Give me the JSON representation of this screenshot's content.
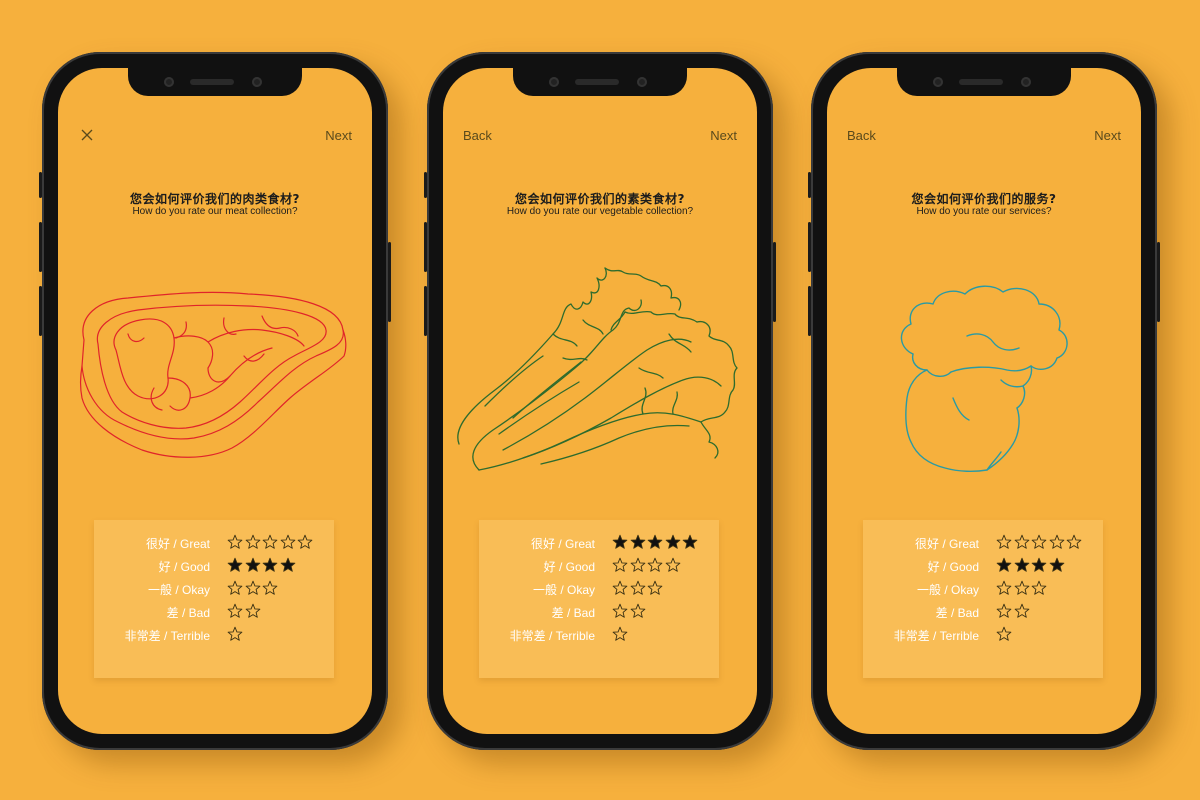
{
  "colors": {
    "background": "#F6B03D",
    "meat_line": "#E0242A",
    "veg_line": "#2E6B2D",
    "chef_line": "#2A9AA4"
  },
  "screens": [
    {
      "nav_left": "",
      "nav_left_icon": "close-icon",
      "nav_right": "Next",
      "question_cn": "您会如何评价我们的肉类食材?",
      "question_en": "How do you rate our meat collection?",
      "illustration": "steak",
      "ratings": [
        {
          "label": "很好 / Great",
          "stars": 5,
          "filled": false
        },
        {
          "label": "好 / Good",
          "stars": 4,
          "filled": true
        },
        {
          "label": "一般 / Okay",
          "stars": 3,
          "filled": false
        },
        {
          "label": "差 / Bad",
          "stars": 2,
          "filled": false
        },
        {
          "label": "非常差 / Terrible",
          "stars": 1,
          "filled": false
        }
      ]
    },
    {
      "nav_left": "Back",
      "nav_right": "Next",
      "question_cn": "您会如何评价我们的素类食材?",
      "question_en": "How do you rate our vegetable collection?",
      "illustration": "cabbage",
      "ratings": [
        {
          "label": "很好 / Great",
          "stars": 5,
          "filled": true
        },
        {
          "label": "好 / Good",
          "stars": 4,
          "filled": false
        },
        {
          "label": "一般 / Okay",
          "stars": 3,
          "filled": false
        },
        {
          "label": "差 / Bad",
          "stars": 2,
          "filled": false
        },
        {
          "label": "非常差 / Terrible",
          "stars": 1,
          "filled": false
        }
      ]
    },
    {
      "nav_left": "Back",
      "nav_right": "Next",
      "question_cn": "您会如何评价我们的服务?",
      "question_en": "How do you rate our services?",
      "illustration": "chef",
      "ratings": [
        {
          "label": "很好 / Great",
          "stars": 5,
          "filled": false
        },
        {
          "label": "好 / Good",
          "stars": 4,
          "filled": true
        },
        {
          "label": "一般 / Okay",
          "stars": 3,
          "filled": false
        },
        {
          "label": "差 / Bad",
          "stars": 2,
          "filled": false
        },
        {
          "label": "非常差 / Terrible",
          "stars": 1,
          "filled": false
        }
      ]
    }
  ]
}
